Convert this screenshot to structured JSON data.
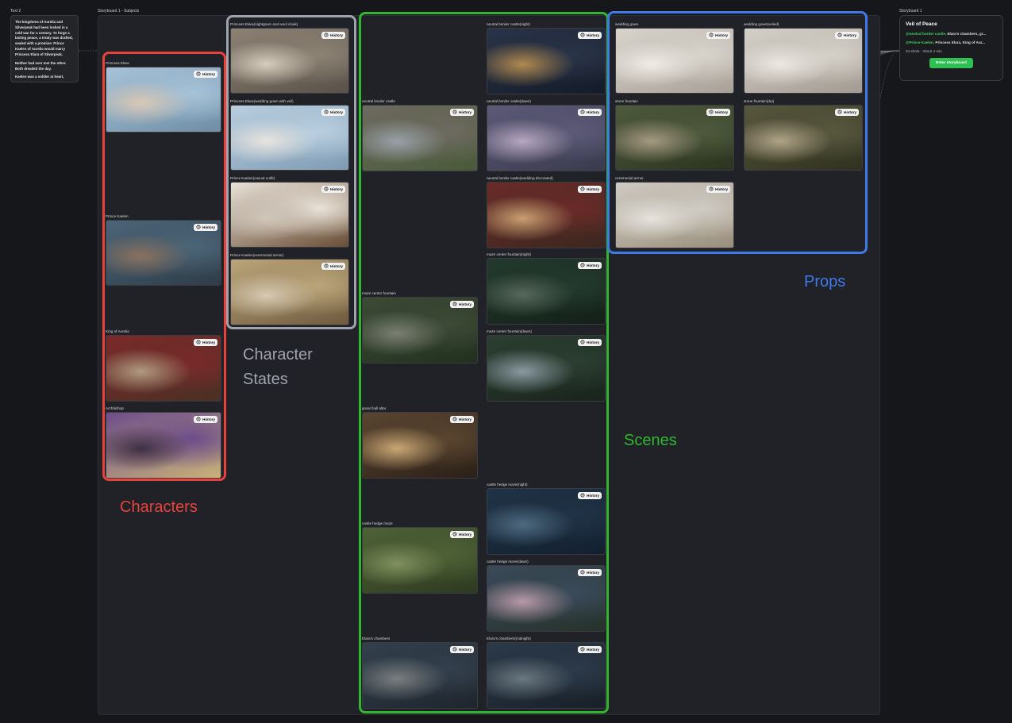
{
  "canvas": {
    "text_node_label": "Text 2",
    "group_label": "Storyboard 1 - Subjects",
    "storyboard_node_label": "Storyboard 1"
  },
  "story_text": {
    "p1": "The kingdoms of Aurelia and Silverpeak had been locked in a cold war for a century. To forge a lasting peace, a treaty was drafted, sealed with a promise: Prince Kaelen of Aurelia would marry Princess Elara of Silverpeak.",
    "p2": "Neither had ever met the other. Both dreaded the day.",
    "p3": "Kaelen was a soldier at heart,"
  },
  "history_label": "History",
  "characters": [
    {
      "label": "Princess Elara",
      "colors": [
        "#a7c3d8",
        "#6f8ea6",
        "#d9c8b6"
      ]
    },
    {
      "label": "Prince Kaelen",
      "colors": [
        "#4b6578",
        "#2f3d49",
        "#8a7260"
      ]
    },
    {
      "label": "King of Aurelia",
      "colors": [
        "#7a2a2a",
        "#4a3024",
        "#b09a80"
      ]
    },
    {
      "label": "Archbishop",
      "colors": [
        "#6d4c8a",
        "#c9b27a",
        "#3e2f45"
      ]
    }
  ],
  "character_states": [
    {
      "label": "Princess Elara(nightgown and wool cloak)",
      "colors": [
        "#8c8274",
        "#5a5249",
        "#d7cdbe"
      ]
    },
    {
      "label": "Princess Elara(wedding gown with veil)",
      "colors": [
        "#b9cfe0",
        "#7f9bb3",
        "#e8e4de"
      ]
    },
    {
      "label": "Prince Kaelen(casual outfit)",
      "colors": [
        "#e9e2d8",
        "#6a4e36",
        "#cfc6ba"
      ]
    },
    {
      "label": "Prince Kaelen(ceremonial armor)",
      "colors": [
        "#bba57a",
        "#6f5a3e",
        "#d6cab2"
      ]
    }
  ],
  "scenes_left": [
    {
      "label": "neutral border castle",
      "colors": [
        "#6e6a60",
        "#4a5a3a",
        "#9aa0a8"
      ]
    },
    {
      "label": "maze center fountain",
      "colors": [
        "#3c4a36",
        "#22301f",
        "#7b8072"
      ]
    },
    {
      "label": "grand hall altar",
      "colors": [
        "#5a4530",
        "#2b2018",
        "#caa774"
      ]
    },
    {
      "label": "castle hedge maze",
      "colors": [
        "#4e6236",
        "#2d3a20",
        "#80915e"
      ]
    },
    {
      "label": "Elara's chambers",
      "colors": [
        "#33404d",
        "#1e252d",
        "#7a7e80"
      ]
    }
  ],
  "scenes_right": [
    {
      "label": "neutral border castle(night)",
      "colors": [
        "#2a3448",
        "#141b28",
        "#b08a50"
      ]
    },
    {
      "label": "neutral border castle(dawn)",
      "colors": [
        "#5c5a78",
        "#3a3a4e",
        "#b6a8c0"
      ]
    },
    {
      "label": "neutral border castle(wedding decorated)",
      "colors": [
        "#6a2a28",
        "#3a2820",
        "#c8a070"
      ]
    },
    {
      "label": "maze center fountain(night)",
      "colors": [
        "#243a2e",
        "#132018",
        "#56685a"
      ]
    },
    {
      "label": "maze center fountain(dawn)",
      "colors": [
        "#2c3e32",
        "#18241c",
        "#8a9aa0"
      ]
    },
    {
      "label": "castle hedge maze(night)",
      "colors": [
        "#203346",
        "#132030",
        "#4e6a80"
      ]
    },
    {
      "label": "castle hedge maze(dawn)",
      "colors": [
        "#3a4a5a",
        "#26322a",
        "#b79aa8"
      ]
    },
    {
      "label": "Elara's chambers(midnight)",
      "colors": [
        "#2c3a4a",
        "#182028",
        "#6a7880"
      ]
    }
  ],
  "props": [
    {
      "label": "wedding gown",
      "colors": [
        "#d8d4cc",
        "#a8a198",
        "#efece6"
      ]
    },
    {
      "label": "wedding gown(veiled)",
      "colors": [
        "#d5d1c9",
        "#a29b92",
        "#ecE9e3"
      ]
    },
    {
      "label": "stone fountain",
      "colors": [
        "#4e5a3c",
        "#2c3320",
        "#a59a82"
      ]
    },
    {
      "label": "stone fountain(dry)",
      "colors": [
        "#58583e",
        "#30311f",
        "#b0a488"
      ]
    },
    {
      "label": "ceremonial armor",
      "colors": [
        "#cfcbc3",
        "#9a8f7c",
        "#e6e3dd"
      ]
    }
  ],
  "annotations": {
    "characters": "Characters",
    "character_states_l1": "Character",
    "character_states_l2": "States",
    "scenes": "Scenes",
    "props": "Props"
  },
  "colors": {
    "characters_frame": "#e8423b",
    "states_frame": "#9ea3ad",
    "scenes_frame": "#2fb82f",
    "props_frame": "#3f7ae8",
    "accent_green": "#2fbf52"
  },
  "storyboard": {
    "title": "Veil of Peace",
    "line1_tag": "@neutral border castle,",
    "line1_rest": " Elara's chambers, gr...",
    "line2_tag": "@Prince Kaelen,",
    "line2_rest": " Princess Elara, King of Aur...",
    "meta": "34 shots · About 4 min",
    "button": "Enter storyboard"
  }
}
